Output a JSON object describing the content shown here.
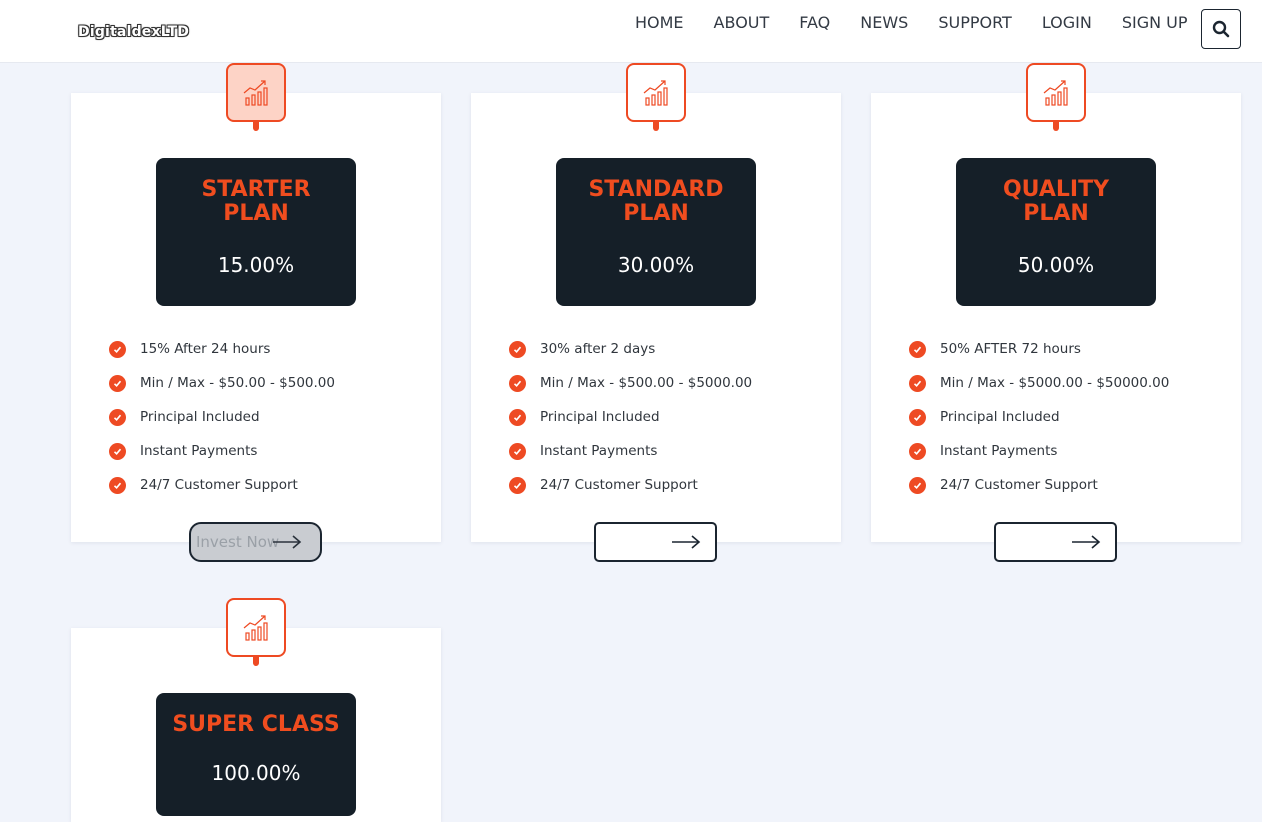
{
  "header": {
    "logo": "DigitaldexLTD",
    "nav": [
      "HOME",
      "ABOUT",
      "FAQ",
      "NEWS",
      "SUPPORT",
      "LOGIN",
      "SIGN UP"
    ],
    "search_icon": "search-icon"
  },
  "plans": [
    {
      "name_line1": "STARTER",
      "name_line2": "PLAN",
      "rate": "15.00%",
      "features": [
        "15% After 24 hours",
        "Min / Max - $50.00 - $500.00",
        "Principal Included",
        "Instant Payments",
        "24/7 Customer Support"
      ],
      "button_label": "Invest Now"
    },
    {
      "name_line1": "STANDARD",
      "name_line2": "PLAN",
      "rate": "30.00%",
      "features": [
        "30% after 2 days",
        "Min / Max - $500.00 - $5000.00",
        "Principal Included",
        "Instant Payments",
        "24/7 Customer Support"
      ],
      "button_label": ""
    },
    {
      "name_line1": "QUALITY",
      "name_line2": "PLAN",
      "rate": "50.00%",
      "features": [
        "50% AFTER 72 hours",
        "Min / Max - $5000.00 - $50000.00",
        "Principal Included",
        "Instant Payments",
        "24/7 Customer Support"
      ],
      "button_label": ""
    },
    {
      "name_line1": "SUPER CLASS",
      "rate": "100.00%"
    }
  ],
  "colors": {
    "accent": "#ee4a23",
    "plan_box": "#151f28",
    "page_bg": "#f1f4fb"
  }
}
